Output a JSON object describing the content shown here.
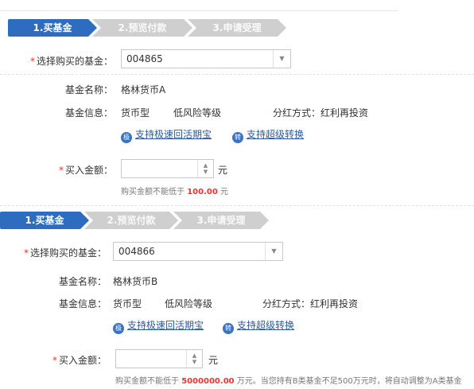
{
  "panels": [
    {
      "steps": [
        "1.买基金",
        "2.预览付款",
        "3.申请受理"
      ],
      "fund_select_label": "选择购买的基金：",
      "fund_code": "004865",
      "fund_name_label": "基金名称：",
      "fund_name": "格林货币A",
      "fund_info_label": "基金信息：",
      "fund_type": "货币型",
      "risk_level": "低风险等级",
      "dividend": "分红方式：红利再投资",
      "feature_1_icon": "极",
      "feature_1": "支持极速回活期宝",
      "feature_2_icon": "转",
      "feature_2": "支持超级转换",
      "amount_label": "买入金额：",
      "amount_value": "",
      "unit": "元",
      "hint_prefix": "购买金额不能低于",
      "hint_amount": "100.00",
      "hint_suffix": "元"
    },
    {
      "steps": [
        "1.买基金",
        "2.预览付款",
        "3.申请受理"
      ],
      "fund_select_label": "选择购买的基金：",
      "fund_code": "004866",
      "fund_name_label": "基金名称：",
      "fund_name": "格林货币B",
      "fund_info_label": "基金信息：",
      "fund_type": "货币型",
      "risk_level": "低风险等级",
      "dividend": "分红方式：红利再投资",
      "feature_1_icon": "极",
      "feature_1": "支持极速回活期宝",
      "feature_2_icon": "转",
      "feature_2": "支持超级转换",
      "amount_label": "买入金额：",
      "amount_value": "",
      "unit": "元",
      "hint_prefix": "购买金额不能低于",
      "hint_amount": "5000000.00",
      "hint_suffix": "万元。当您持有B类基金不足500万元时，将自动调整为A类基金"
    }
  ],
  "required_mark": "*"
}
